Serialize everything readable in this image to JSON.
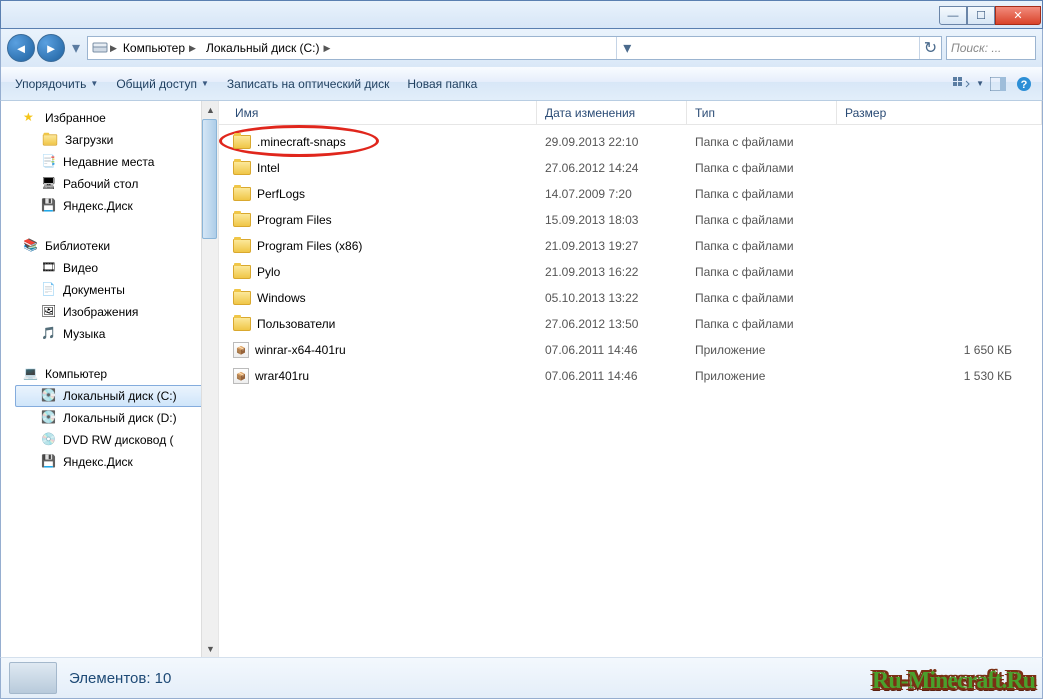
{
  "window": {
    "title": ""
  },
  "breadcrumb": {
    "items": [
      "Компьютер",
      "Локальный диск (C:)"
    ]
  },
  "search": {
    "placeholder": "Поиск: ..."
  },
  "toolbar": {
    "organize": "Упорядочить",
    "share": "Общий доступ",
    "burn": "Записать на оптический диск",
    "newfolder": "Новая папка"
  },
  "sidebar": {
    "favorites": {
      "label": "Избранное",
      "items": [
        "Загрузки",
        "Недавние места",
        "Рабочий стол",
        "Яндекс.Диск"
      ]
    },
    "libraries": {
      "label": "Библиотеки",
      "items": [
        "Видео",
        "Документы",
        "Изображения",
        "Музыка"
      ]
    },
    "computer": {
      "label": "Компьютер",
      "items": [
        "Локальный диск (C:)",
        "Локальный диск (D:)",
        "DVD RW дисковод (",
        "Яндекс.Диск"
      ]
    }
  },
  "columns": {
    "name": "Имя",
    "date": "Дата изменения",
    "type": "Тип",
    "size": "Размер"
  },
  "files": [
    {
      "name": ".minecraft-snaps",
      "date": "29.09.2013 22:10",
      "type": "Папка с файлами",
      "size": "",
      "icon": "folder",
      "highlighted": true
    },
    {
      "name": "Intel",
      "date": "27.06.2012 14:24",
      "type": "Папка с файлами",
      "size": "",
      "icon": "folder"
    },
    {
      "name": "PerfLogs",
      "date": "14.07.2009 7:20",
      "type": "Папка с файлами",
      "size": "",
      "icon": "folder"
    },
    {
      "name": "Program Files",
      "date": "15.09.2013 18:03",
      "type": "Папка с файлами",
      "size": "",
      "icon": "folder"
    },
    {
      "name": "Program Files (x86)",
      "date": "21.09.2013 19:27",
      "type": "Папка с файлами",
      "size": "",
      "icon": "folder"
    },
    {
      "name": "Pylo",
      "date": "21.09.2013 16:22",
      "type": "Папка с файлами",
      "size": "",
      "icon": "folder"
    },
    {
      "name": "Windows",
      "date": "05.10.2013 13:22",
      "type": "Папка с файлами",
      "size": "",
      "icon": "folder"
    },
    {
      "name": "Пользователи",
      "date": "27.06.2012 13:50",
      "type": "Папка с файлами",
      "size": "",
      "icon": "folder"
    },
    {
      "name": "winrar-x64-401ru",
      "date": "07.06.2011 14:46",
      "type": "Приложение",
      "size": "1 650 КБ",
      "icon": "exe"
    },
    {
      "name": "wrar401ru",
      "date": "07.06.2011 14:46",
      "type": "Приложение",
      "size": "1 530 КБ",
      "icon": "exe"
    }
  ],
  "details": {
    "count_label": "Элементов: 10"
  },
  "watermark": "Ru-Minecraft.Ru"
}
